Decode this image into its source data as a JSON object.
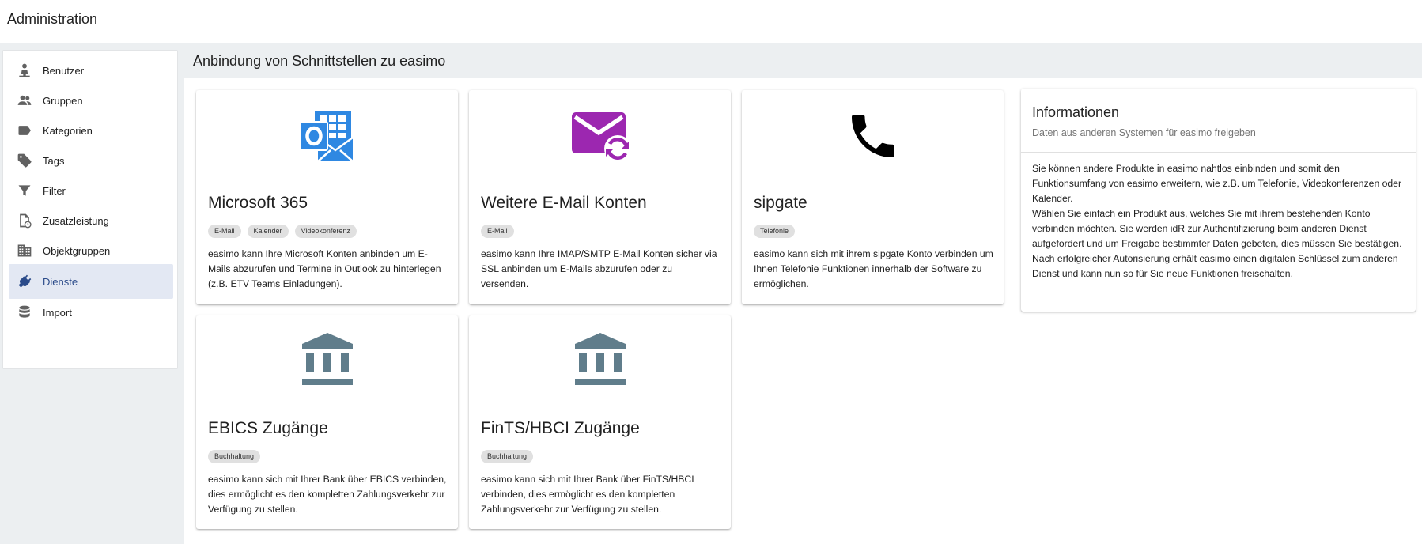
{
  "app": {
    "title": "Administration"
  },
  "sidebar": {
    "items": [
      {
        "label": "Benutzer",
        "icon": "person-icon"
      },
      {
        "label": "Gruppen",
        "icon": "group-icon"
      },
      {
        "label": "Kategorien",
        "icon": "label-icon"
      },
      {
        "label": "Tags",
        "icon": "tags-icon"
      },
      {
        "label": "Filter",
        "icon": "filter-icon"
      },
      {
        "label": "Zusatzleistung",
        "icon": "document-clock-icon"
      },
      {
        "label": "Objektgruppen",
        "icon": "building-icon"
      },
      {
        "label": "Dienste",
        "icon": "plug-icon",
        "active": true
      },
      {
        "label": "Import",
        "icon": "database-icon"
      }
    ]
  },
  "main": {
    "header": "Anbindung von Schnittstellen zu easimo",
    "cards": [
      {
        "title": "Microsoft 365",
        "icon": "outlook-icon",
        "icon_color": "#2f88e2",
        "chips": [
          "E-Mail",
          "Kalender",
          "Videokonferenz"
        ],
        "description": "easimo kann Ihre Microsoft Konten anbinden um E-Mails abzurufen und Termine in Outlook zu hinterlegen (z.B. ETV Teams Einladungen)."
      },
      {
        "title": "Weitere E-Mail Konten",
        "icon": "email-sync-icon",
        "icon_color": "#9c27b0",
        "chips": [
          "E-Mail"
        ],
        "description": "easimo kann Ihre IMAP/SMTP E-Mail Konten sicher via SSL anbinden um E-Mails abzurufen oder zu versenden."
      },
      {
        "title": "sipgate",
        "icon": "phone-icon",
        "icon_color": "#000000",
        "chips": [
          "Telefonie"
        ],
        "description": "easimo kann sich mit ihrem sipgate Konto verbinden um Ihnen Telefonie Funktionen innerhalb der Software zu ermöglichen."
      },
      {
        "title": "EBICS Zugänge",
        "icon": "bank-icon",
        "icon_color": "#607d8b",
        "chips": [
          "Buchhaltung"
        ],
        "description": "easimo kann sich mit Ihrer Bank über EBICS verbinden, dies ermöglicht es den kompletten Zahlungsverkehr zur Verfügung zu stellen."
      },
      {
        "title": "FinTS/HBCI Zugänge",
        "icon": "bank-icon",
        "icon_color": "#607d8b",
        "chips": [
          "Buchhaltung"
        ],
        "description": "easimo kann sich mit Ihrer Bank über FinTS/HBCI verbinden, dies ermöglicht es den kompletten Zahlungsverkehr zur Verfügung zu stellen."
      }
    ],
    "info": {
      "title": "Informationen",
      "subtitle": "Daten aus anderen Systemen für easimo freigeben",
      "paragraphs": [
        "Sie können andere Produkte in easimo nahtlos einbinden und somit den Funktionsumfang von easimo erweitern, wie z.B. um Telefonie, Videokonferenzen oder Kalender.",
        "Wählen Sie einfach ein Produkt aus, welches Sie mit ihrem bestehenden Konto verbinden möchten. Sie werden idR zur Authentifizierung beim anderen Dienst aufgefordert und um Freigabe bestimmter Daten gebeten, dies müssen Sie bestätigen.",
        "Nach erfolgreicher Autorisierung erhält easimo einen digitalen Schlüssel zum anderen Dienst und kann nun so für Sie neue Funktionen freischalten."
      ]
    }
  }
}
